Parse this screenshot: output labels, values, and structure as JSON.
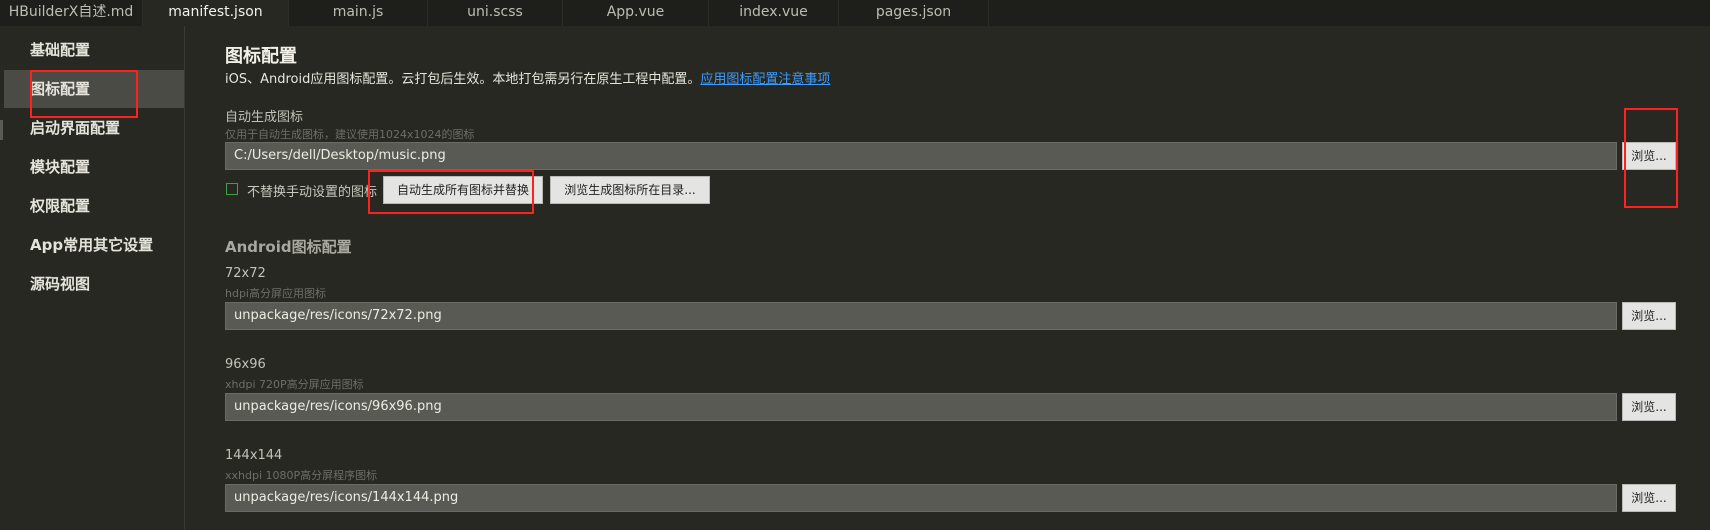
{
  "tabs": [
    {
      "label": "HBuilderX自述.md",
      "active": false
    },
    {
      "label": "manifest.json",
      "active": true
    },
    {
      "label": "main.js",
      "active": false
    },
    {
      "label": "uni.scss",
      "active": false
    },
    {
      "label": "App.vue",
      "active": false
    },
    {
      "label": "index.vue",
      "active": false
    },
    {
      "label": "pages.json",
      "active": false
    }
  ],
  "sidebar": {
    "items": [
      {
        "label": "基础配置"
      },
      {
        "label": "图标配置",
        "active": true
      },
      {
        "label": "启动界面配置"
      },
      {
        "label": "模块配置"
      },
      {
        "label": "权限配置"
      },
      {
        "label": "App常用其它设置"
      },
      {
        "label": "源码视图"
      }
    ]
  },
  "main": {
    "title": "图标配置",
    "description": "iOS、Android应用图标配置。云打包后生效。本地打包需另行在原生工程中配置。",
    "description_link": "应用图标配置注意事项",
    "auto": {
      "label": "自动生成图标",
      "hint": "仅用于自动生成图标，建议使用1024x1024的图标",
      "value": "C:/Users/dell/Desktop/music.png",
      "browse_label": "浏览...",
      "checkbox_label": "不替换手动设置的图标",
      "checkbox_checked": false,
      "generate_label": "自动生成所有图标并替换",
      "open_dir_label": "浏览生成图标所在目录..."
    },
    "android": {
      "section_title": "Android图标配置",
      "icons": [
        {
          "size": "72x72",
          "hint": "hdpi高分屏应用图标",
          "value": "unpackage/res/icons/72x72.png",
          "browse_label": "浏览..."
        },
        {
          "size": "96x96",
          "hint": "xhdpi 720P高分屏应用图标",
          "value": "unpackage/res/icons/96x96.png",
          "browse_label": "浏览..."
        },
        {
          "size": "144x144",
          "hint": "xxhdpi 1080P高分屏程序图标",
          "value": "unpackage/res/icons/144x144.png",
          "browse_label": "浏览..."
        }
      ]
    }
  },
  "colors": {
    "background": "#272822",
    "sidebar_active": "#4a4b44",
    "link": "#3c9cff",
    "highlight_box": "#ff2020",
    "checkbox_border": "#3fa04a"
  }
}
